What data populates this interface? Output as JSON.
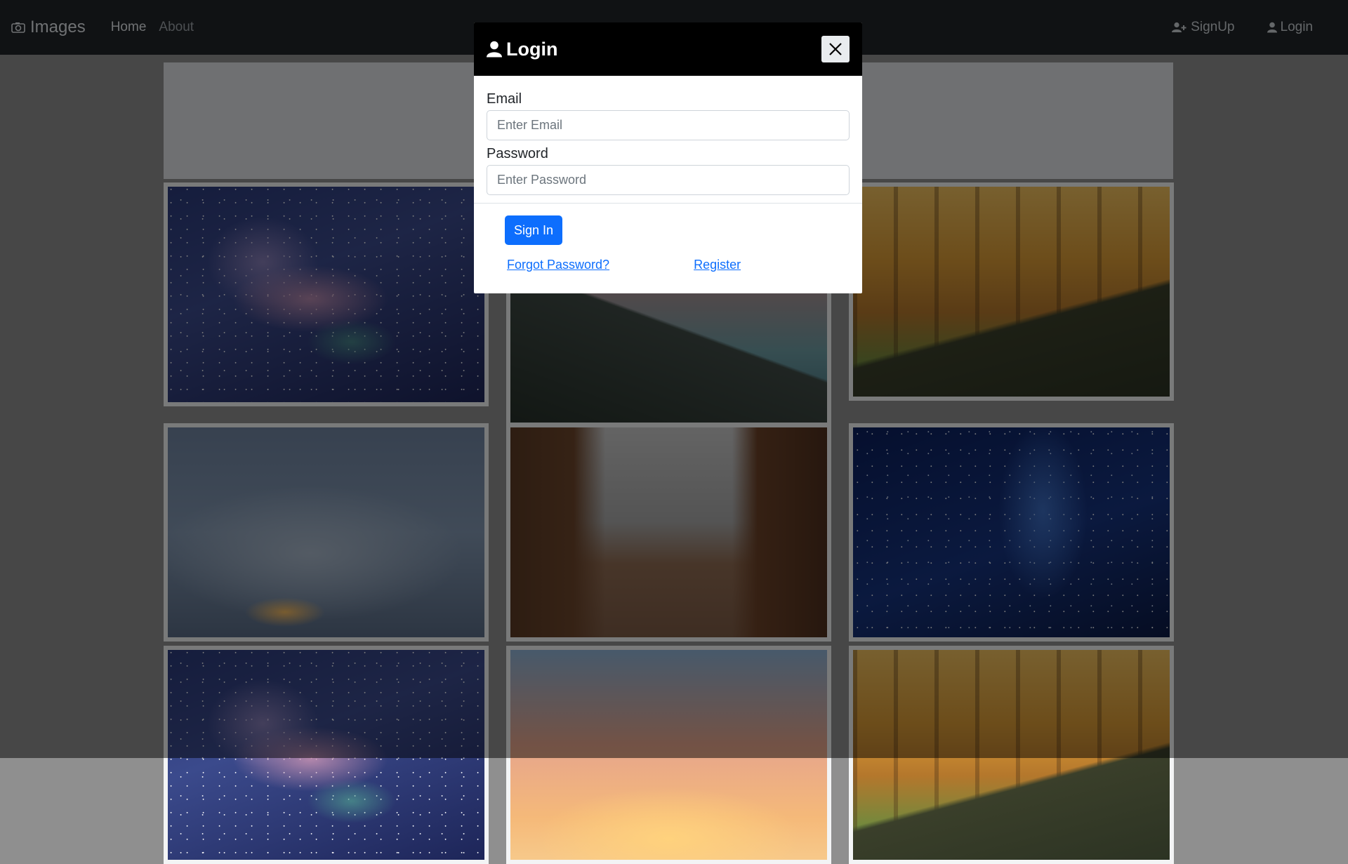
{
  "navbar": {
    "brand": "Images",
    "links": [
      "Home",
      "About"
    ],
    "signup_label": "SignUp",
    "login_label": "Login"
  },
  "gallery": {
    "images": [
      {
        "name": "galaxy-image"
      },
      {
        "name": "lake-coast-image"
      },
      {
        "name": "autumn-forest-image"
      },
      {
        "name": "birds-sky-image"
      },
      {
        "name": "beach-cliffs-image"
      },
      {
        "name": "night-sky-image"
      },
      {
        "name": "galaxy-image-2"
      },
      {
        "name": "sunset-image"
      },
      {
        "name": "autumn-forest-image-2"
      }
    ]
  },
  "modal": {
    "title": "Login",
    "email_label": "Email",
    "email_placeholder": "Enter Email",
    "email_value": "",
    "password_label": "Password",
    "password_placeholder": "Enter Password",
    "password_value": "",
    "signin_label": "Sign In",
    "forgot_label": "Forgot Password?",
    "register_label": "Register"
  },
  "colors": {
    "navbar_bg": "#212529",
    "modal_header_bg": "#000000",
    "primary": "#0d6efd"
  }
}
